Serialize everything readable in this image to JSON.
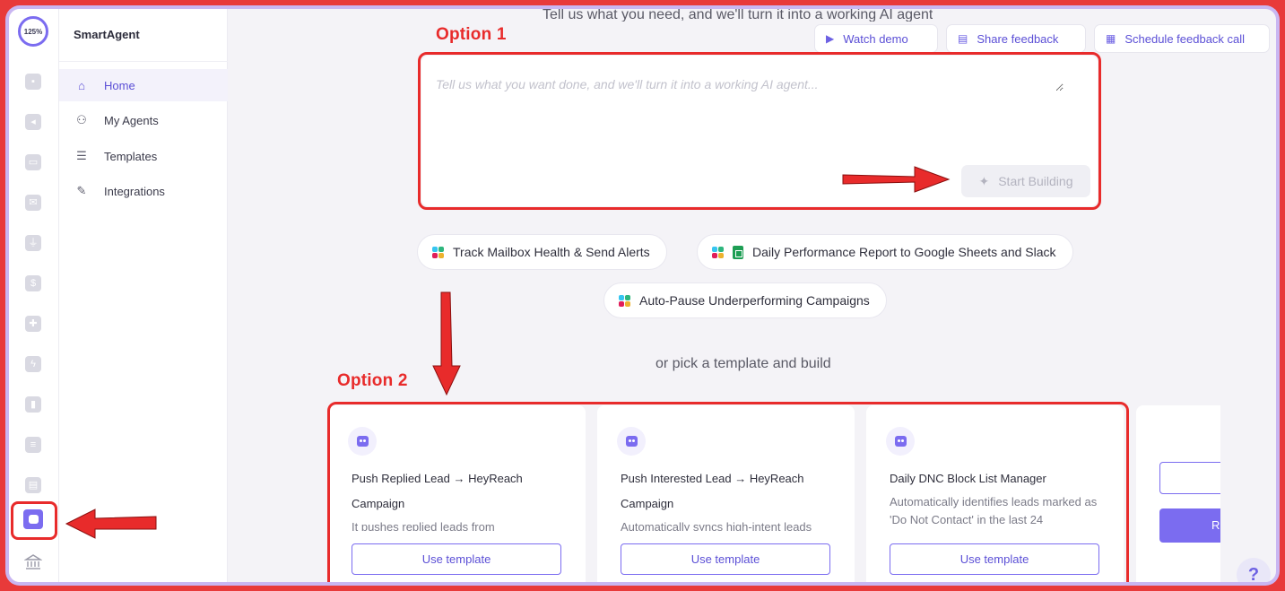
{
  "rail": {
    "zoom": "125%"
  },
  "nav": {
    "brand": "SmartAgent",
    "items": [
      {
        "label": "Home",
        "icon": "home-icon"
      },
      {
        "label": "My Agents",
        "icon": "agent-icon"
      },
      {
        "label": "Templates",
        "icon": "template-icon"
      },
      {
        "label": "Integrations",
        "icon": "plug-icon"
      }
    ]
  },
  "header": {
    "heading": "Tell us what you need, and we'll turn it into a working AI agent",
    "watch_demo": "Watch demo",
    "share_feedback": "Share feedback",
    "schedule_call": "Schedule feedback call"
  },
  "prompt": {
    "placeholder": "Tell us what you want done, and we'll turn it into a working AI agent...",
    "start_label": "Start Building"
  },
  "annotations": {
    "option1": "Option 1",
    "option2": "Option 2"
  },
  "chips": [
    "Track Mailbox Health & Send Alerts",
    "Daily Performance Report to Google Sheets and Slack",
    "Auto-Pause Underperforming Campaigns"
  ],
  "templates_heading": "or pick a template and build",
  "templates": [
    {
      "title": "Push Replied Lead → HeyReach Campaign",
      "desc": "It pushes replied leads from",
      "button": "Use template"
    },
    {
      "title": "Push Interested Lead → HeyReach Campaign",
      "desc": "Automatically syncs high-intent leads",
      "button": "Use template"
    },
    {
      "title": "Daily DNC Block List Manager",
      "desc": "Automatically identifies leads marked as 'Do Not Contact' in the last 24",
      "button": "Use template"
    }
  ],
  "partial_card_button": "R",
  "help_label": "?",
  "colors": {
    "accent": "#7b6cf0",
    "annotation": "#e82b2b"
  }
}
